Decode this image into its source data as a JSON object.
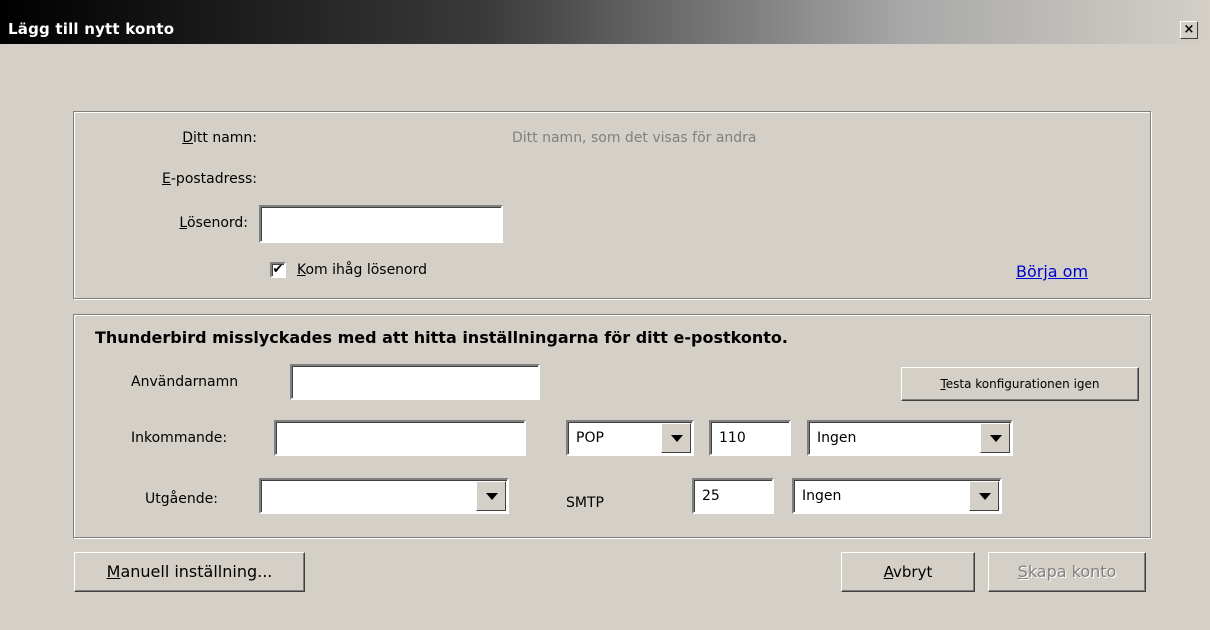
{
  "window": {
    "title": "Lägg till nytt konto",
    "close_glyph": "×"
  },
  "identity": {
    "name_label": "Ditt namn:",
    "name_placeholder": "Ditt namn, som det visas för andra",
    "email_label": "E-postadress:",
    "password_label": "Lösenord:",
    "password_value": "",
    "remember_label": "Kom ihåg lösenord",
    "remember_checked": true,
    "restart_link": "Börja om"
  },
  "config": {
    "failure_message": "Thunderbird misslyckades med att hitta inställningarna för ditt e-postkonto.",
    "username_label": "Användarnamn",
    "username_value": "",
    "retest_button": "Testa konfigurationen igen",
    "incoming_label": "Inkommande:",
    "incoming_value": "",
    "incoming_protocol": "POP",
    "incoming_port": "110",
    "incoming_security": "Ingen",
    "outgoing_label": "Utgående:",
    "outgoing_value": "",
    "outgoing_protocol": "SMTP",
    "outgoing_port": "25",
    "outgoing_security": "Ingen"
  },
  "buttons": {
    "manual": "Manuell inställning...",
    "cancel": "Avbryt",
    "create": "Skapa konto"
  },
  "icons": {
    "close": "close-icon",
    "checkmark": "checkmark-icon",
    "dropdown": "dropdown-arrow-icon"
  }
}
